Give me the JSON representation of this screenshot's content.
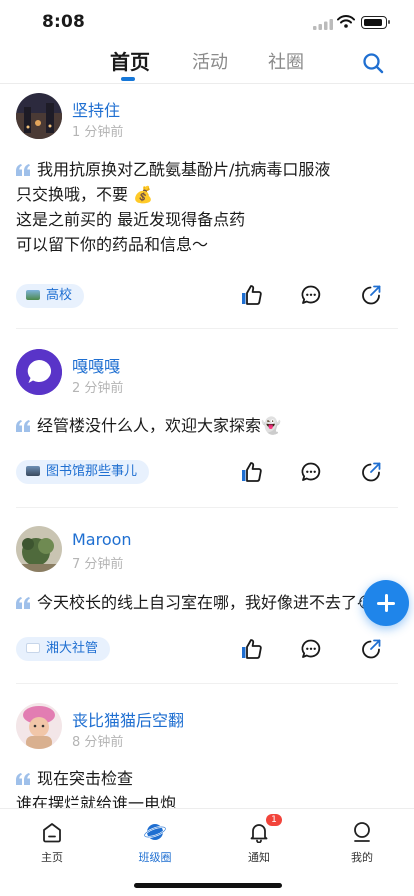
{
  "status_bar": {
    "time": "8:08"
  },
  "top_tabs": {
    "home": "首页",
    "activity": "活动",
    "circle": "社圈",
    "active": "home"
  },
  "posts": [
    {
      "username": "坚持住",
      "time": "1 分钟前",
      "lines": [
        "我用抗原换对乙酰氨基酚片/抗病毒口服液",
        "只交换哦，不要 💰",
        "这是之前买的 最近发现得备点药",
        "可以留下你的药品和信息～"
      ],
      "tag": "高校"
    },
    {
      "username": "嘎嘎嘎",
      "time": "2 分钟前",
      "lines": [
        "经管楼没什么人，欢迎大家探索👻"
      ],
      "tag": "图书馆那些事儿"
    },
    {
      "username": "Maroon",
      "time": "7 分钟前",
      "lines": [
        "今天校长的线上自习室在哪，我好像进不去了😭"
      ],
      "tag": "湘大社管"
    },
    {
      "username": "丧比猫猫后空翻",
      "time": "8 分钟前",
      "lines": [
        "现在突击检查",
        "谁在摆烂就给谁一电炮"
      ],
      "tag": ""
    }
  ],
  "bottom_nav": {
    "home": "主页",
    "class_circle": "班级圈",
    "notify": "通知",
    "notify_badge": "1",
    "mine": "我的",
    "active": "class_circle"
  },
  "colors": {
    "accent": "#1f6fd1",
    "tag_bg": "#e8f1fd",
    "fab": "#1f85ea",
    "badge": "#f2443b"
  },
  "icons": [
    "signal-icon",
    "wifi-icon",
    "battery-icon",
    "search-icon",
    "quote-icon",
    "like-icon",
    "comment-icon",
    "share-icon",
    "add-icon",
    "home-icon",
    "planet-icon",
    "bell-icon",
    "user-icon"
  ]
}
